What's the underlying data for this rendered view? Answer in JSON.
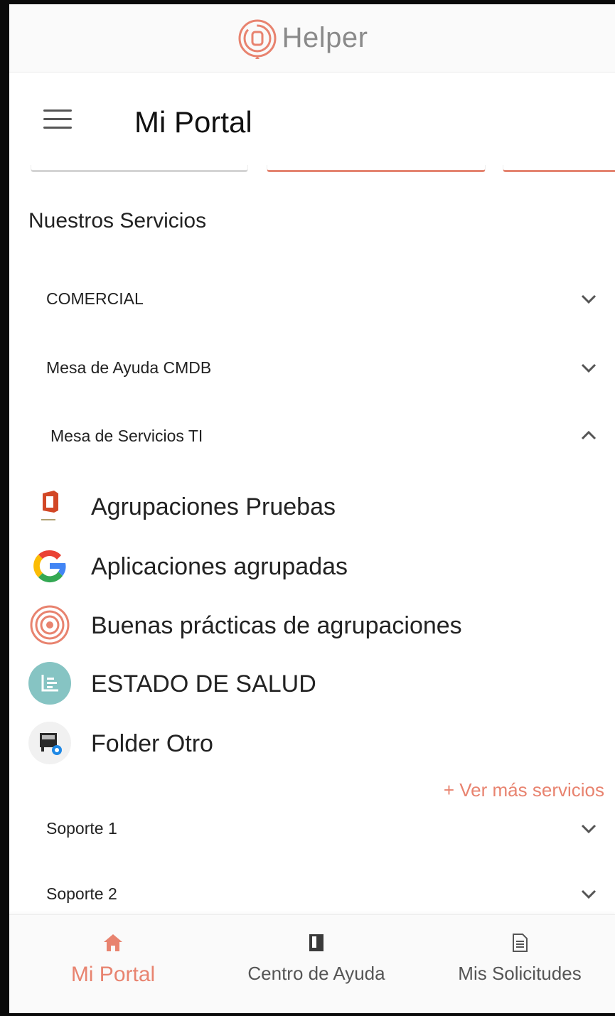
{
  "brand": {
    "name": "Helper",
    "accent": "#e8836f"
  },
  "header": {
    "title": "Mi Portal"
  },
  "section": {
    "title": "Nuestros Servicios"
  },
  "categories": [
    {
      "label": "COMERCIAL",
      "state": "collapsed"
    },
    {
      "label": "Mesa de Ayuda CMDB",
      "state": "collapsed"
    },
    {
      "label": "Mesa de Servicios TI",
      "state": "expanded"
    },
    {
      "label": "Soporte 1",
      "state": "collapsed"
    },
    {
      "label": "Soporte 2",
      "state": "collapsed"
    }
  ],
  "services": [
    {
      "label": "Agrupaciones Pruebas",
      "icon": "office-icon"
    },
    {
      "label": "Aplicaciones agrupadas",
      "icon": "google-icon"
    },
    {
      "label": "Buenas prácticas de agrupaciones",
      "icon": "helper-logo-icon"
    },
    {
      "label": "ESTADO DE SALUD",
      "icon": "health-chart-icon"
    },
    {
      "label": "Folder Otro",
      "icon": "folder-screen-icon"
    }
  ],
  "more_services": "+ Ver más servicios",
  "bottom_nav": [
    {
      "label": "Mi Portal",
      "icon": "home-icon",
      "active": true
    },
    {
      "label": "Centro de Ayuda",
      "icon": "book-icon",
      "active": false
    },
    {
      "label": "Mis Solicitudes",
      "icon": "document-icon",
      "active": false
    }
  ]
}
